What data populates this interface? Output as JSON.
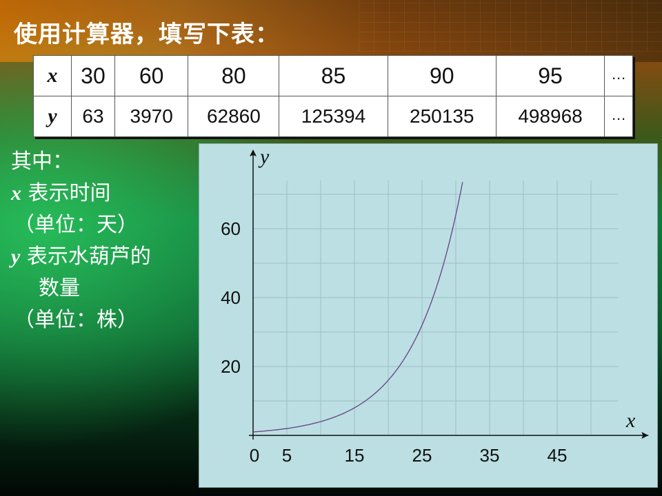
{
  "heading": "使用计算器，填写下表：",
  "table": {
    "x_label": "x",
    "y_label": "y",
    "x_values": [
      "30",
      "60",
      "80",
      "85",
      "90",
      "95",
      "…"
    ],
    "y_values": [
      "63",
      "3970",
      "62860",
      "125394",
      "250135",
      "498968",
      "…"
    ]
  },
  "notes": {
    "line1": "其中：",
    "x_var": "x",
    "x_desc": " 表示时间",
    "x_unit": "（单位：天）",
    "y_var": "y",
    "y_desc": " 表示水葫芦的",
    "y_desc2": "数量",
    "y_unit": "（单位：株）"
  },
  "chart_data": {
    "type": "line",
    "xlabel": "x",
    "ylabel": "y",
    "x_ticks": [
      "0",
      "5",
      "15",
      "25",
      "35",
      "45"
    ],
    "y_ticks": [
      "20",
      "40",
      "60"
    ],
    "xlim": [
      0,
      54
    ],
    "ylim": [
      0,
      76
    ],
    "grid": true,
    "series": [
      {
        "curve": "y = 2^(x/5)",
        "x": [
          0,
          5,
          10,
          15,
          20,
          25,
          28,
          30,
          31
        ],
        "y": [
          1,
          2,
          4,
          8,
          16,
          32,
          48.5,
          64,
          73.5
        ]
      }
    ],
    "colors": {
      "curve": "#6a4a8a",
      "grid": "#9cbfc4",
      "axis": "#111111"
    }
  }
}
